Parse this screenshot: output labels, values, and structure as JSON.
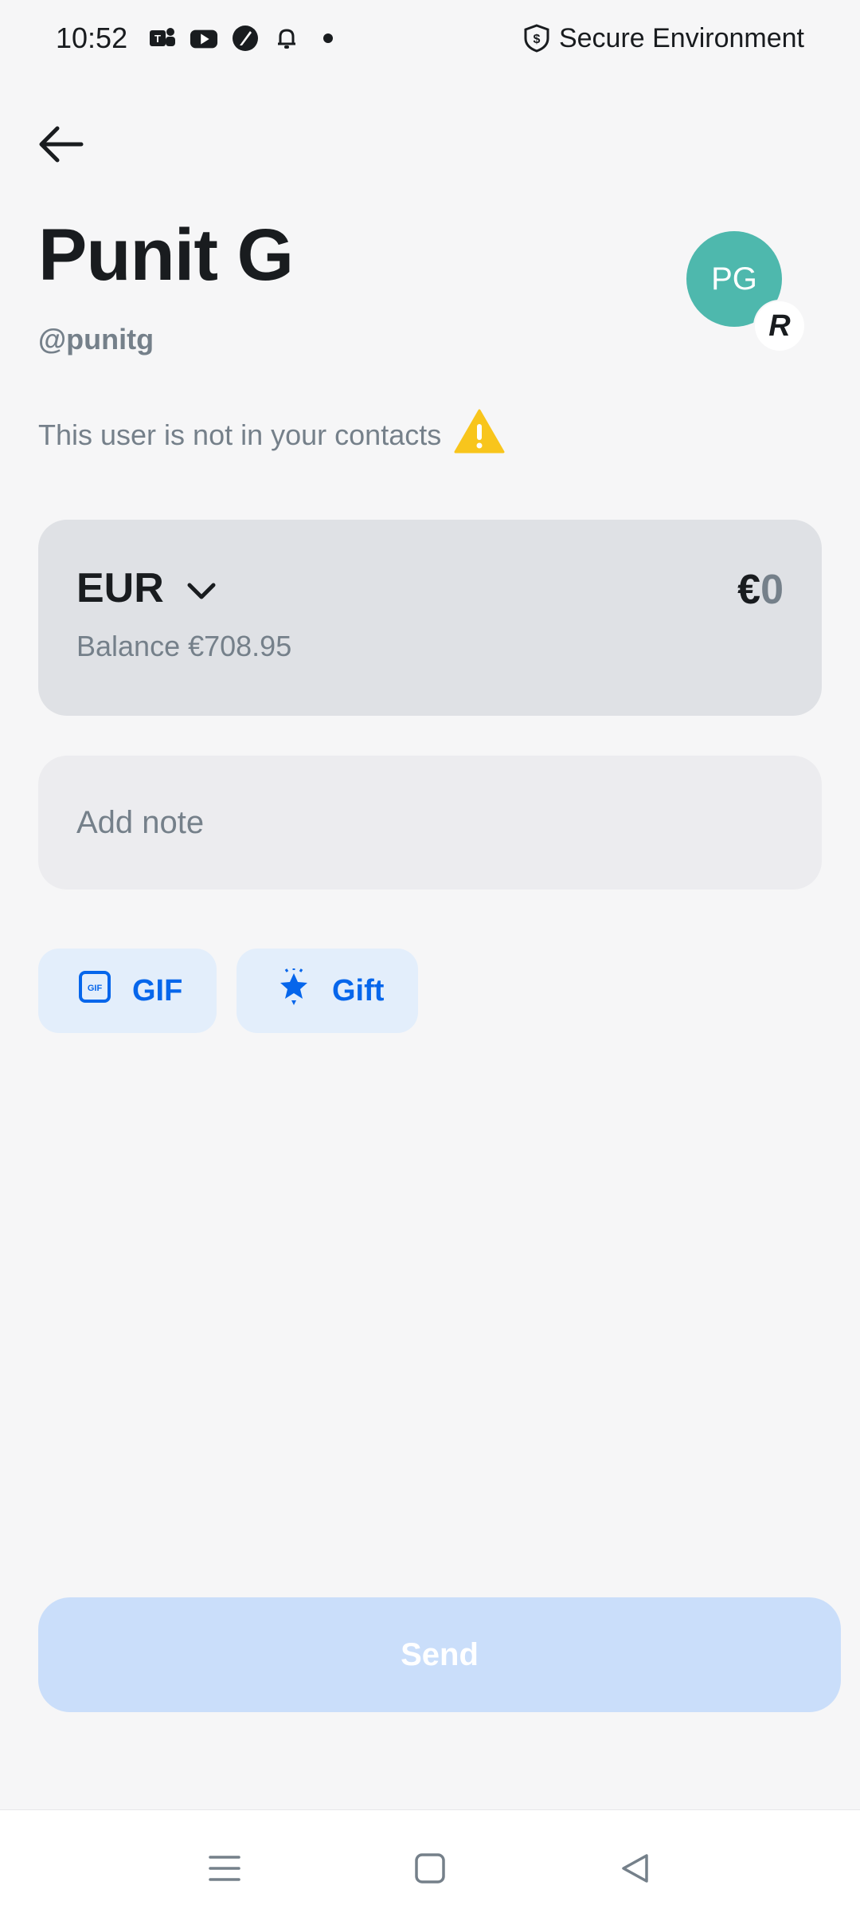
{
  "status_bar": {
    "time": "10:52",
    "icons": [
      "teams-icon",
      "youtube-icon",
      "feather-app-icon",
      "bell-icon",
      "dot-icon"
    ],
    "secure_label": "Secure Environment"
  },
  "header": {
    "name": "Punit G",
    "handle": "@punitg",
    "avatar_initials": "PG",
    "avatar_badge": "R"
  },
  "contact_warning": "This user is not in your contacts",
  "currency_card": {
    "currency": "EUR",
    "balance": "Balance €708.95",
    "amount_symbol": "€",
    "amount_value": "0"
  },
  "note": {
    "placeholder": "Add note"
  },
  "chips": {
    "gif_label": "GIF",
    "gift_label": "Gift"
  },
  "send_label": "Send",
  "colors": {
    "background": "#f6f6f7",
    "avatar": "#4eb8ad",
    "accent": "#0666eb",
    "send_disabled": "#cadefa",
    "warning": "#f8c51c"
  }
}
